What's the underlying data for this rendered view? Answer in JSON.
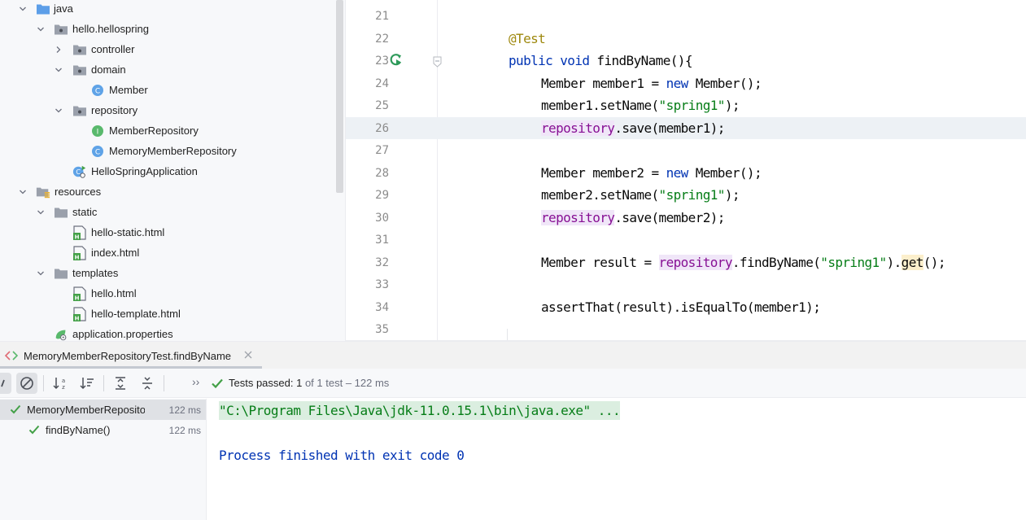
{
  "project_tree": {
    "items": [
      {
        "label": "java",
        "icon": "source-folder-icon"
      },
      {
        "label": "hello.hellospring",
        "icon": "package-icon"
      },
      {
        "label": "controller",
        "icon": "package-icon"
      },
      {
        "label": "domain",
        "icon": "package-icon"
      },
      {
        "label": "Member",
        "icon": "class-icon"
      },
      {
        "label": "repository",
        "icon": "package-icon"
      },
      {
        "label": "MemberRepository",
        "icon": "interface-icon"
      },
      {
        "label": "MemoryMemberRepository",
        "icon": "class-icon"
      },
      {
        "label": "HelloSpringApplication",
        "icon": "spring-boot-class-icon"
      },
      {
        "label": "resources",
        "icon": "resources-folder-icon"
      },
      {
        "label": "static",
        "icon": "folder-icon"
      },
      {
        "label": "hello-static.html",
        "icon": "html-file-icon"
      },
      {
        "label": "index.html",
        "icon": "html-file-icon"
      },
      {
        "label": "templates",
        "icon": "folder-icon"
      },
      {
        "label": "hello.html",
        "icon": "html-file-icon"
      },
      {
        "label": "hello-template.html",
        "icon": "html-file-icon"
      },
      {
        "label": "application.properties",
        "icon": "properties-file-icon"
      }
    ]
  },
  "editor": {
    "lines": [
      {
        "num": "21"
      },
      {
        "num": "22",
        "t1": "@Test"
      },
      {
        "num": "23",
        "t1": "public",
        "t2": " ",
        "t3": "void",
        "t4": " findByName(){"
      },
      {
        "num": "24",
        "t1": "Member member1 = ",
        "t2": "new",
        "t3": " Member();"
      },
      {
        "num": "25",
        "t1": "member1.setName(",
        "t2": "\"spring1\"",
        "t3": ");"
      },
      {
        "num": "26",
        "t1": "repository",
        "t2": ".save(member1);"
      },
      {
        "num": "27"
      },
      {
        "num": "28",
        "t1": "Member member2 = ",
        "t2": "new",
        "t3": " Member();"
      },
      {
        "num": "29",
        "t1": "member2.setName(",
        "t2": "\"spring1\"",
        "t3": ");"
      },
      {
        "num": "30",
        "t1": "repository",
        "t2": ".save(member2);"
      },
      {
        "num": "31"
      },
      {
        "num": "32",
        "t1": "Member result = ",
        "t2": "repository",
        "t3": ".findByName(",
        "t4": "\"spring1\"",
        "t5": ").",
        "t6": "get",
        "t7": "();"
      },
      {
        "num": "33"
      },
      {
        "num": "34",
        "t1": "assertThat(result).isEqualTo(member1);"
      },
      {
        "num": "35"
      }
    ]
  },
  "run": {
    "tab_title": "MemoryMemberRepositoryTest.findByName",
    "status_prefix": "Tests passed: ",
    "passed_count": "1",
    "of_text": " of 1 test",
    "duration_text": " – 122 ms",
    "more_glyph": "››",
    "results": [
      {
        "label": "MemoryMemberRepositoryTest",
        "time": "122 ms"
      },
      {
        "label": "findByName()",
        "time": "122 ms"
      }
    ],
    "console": {
      "command": "\"C:\\Program Files\\Java\\jdk-11.0.15.1\\bin\\java.exe\" ...",
      "exit_line": "Process finished with exit code 0"
    }
  },
  "colors": {
    "keyword": "#0033b3",
    "string": "#067d17",
    "annotation": "#9e880d",
    "field": "#871094",
    "pass_green": "#43a047"
  }
}
